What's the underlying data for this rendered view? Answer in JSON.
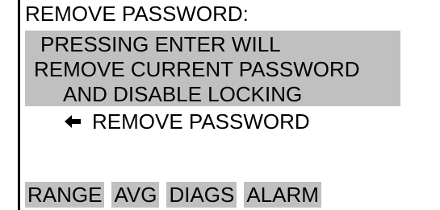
{
  "screen": {
    "title": "REMOVE PASSWORD:",
    "message": {
      "line1": "PRESSING ENTER WILL",
      "line2": "REMOVE CURRENT PASSWORD",
      "line3": "AND DISABLE LOCKING"
    },
    "action": {
      "icon": "left-arrow-icon",
      "label": "REMOVE PASSWORD"
    },
    "softkeys": [
      {
        "label": "RANGE"
      },
      {
        "label": "AVG"
      },
      {
        "label": "DIAGS"
      },
      {
        "label": "ALARM"
      }
    ]
  },
  "colors": {
    "highlight": "#c0c0c0",
    "text": "#000000",
    "background": "#ffffff"
  }
}
